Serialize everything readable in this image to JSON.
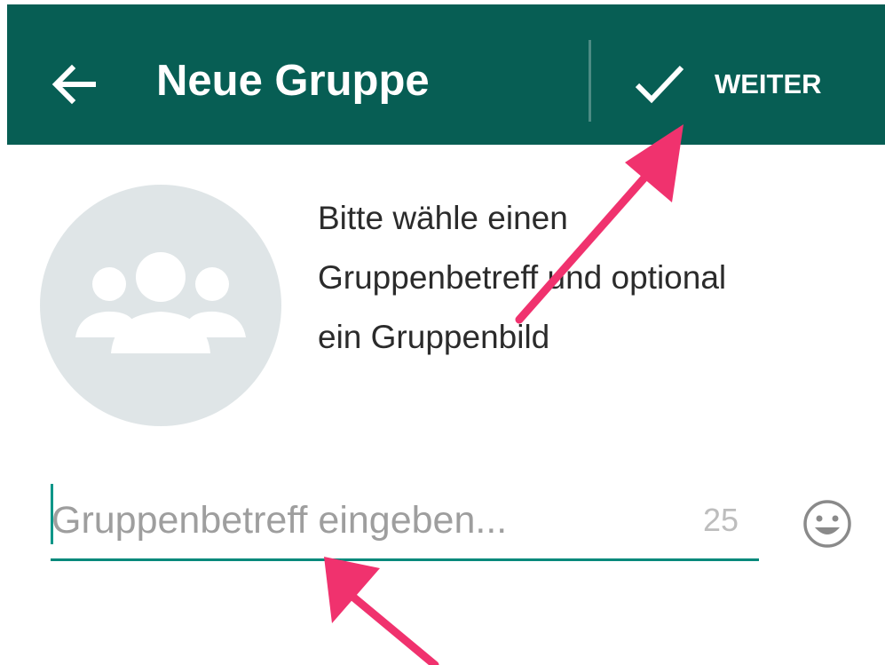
{
  "header": {
    "title": "Neue Gruppe",
    "next_label": "WEITER",
    "background_color": "#075e54",
    "back_icon": "arrow-left-icon",
    "confirm_icon": "checkmark-icon"
  },
  "group_photo": {
    "icon": "group-people-icon",
    "background_color": "#dfe5e7"
  },
  "hint": {
    "lines": [
      "Bitte wähle einen",
      "Gruppenbetreff und optional",
      "ein Gruppenbild"
    ]
  },
  "subject": {
    "placeholder": "Gruppenbetreff eingeben...",
    "value": "",
    "remaining_chars": "25",
    "accent_color": "#00897b",
    "emoji_icon": "smiley-icon"
  },
  "annotations": {
    "arrow_color": "#f0326e"
  }
}
